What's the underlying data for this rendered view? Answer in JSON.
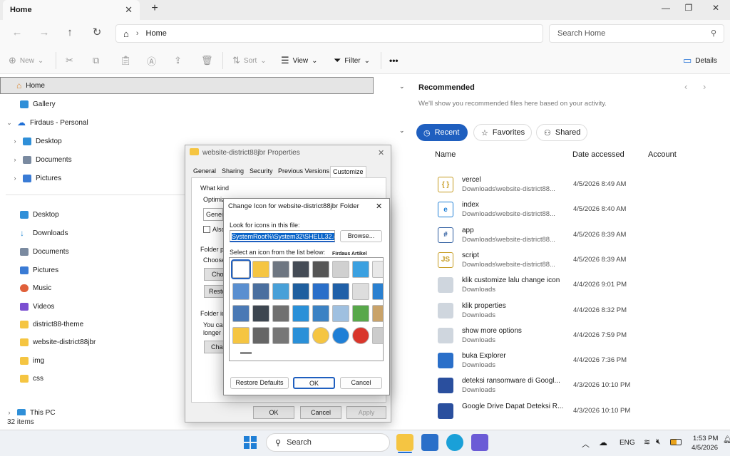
{
  "window": {
    "tab_title": "Home",
    "tab_close": "✕",
    "new_tab": "+",
    "minimize": "—",
    "maximize": "❐",
    "close": "✕"
  },
  "address": {
    "location": "Home",
    "search_placeholder": "Search Home"
  },
  "toolbar": {
    "new_label": "New",
    "sort_label": "Sort",
    "view_label": "View",
    "filter_label": "Filter",
    "more_label": "•••",
    "details_label": "Details"
  },
  "nav": {
    "home": "Home",
    "gallery": "Gallery",
    "onedrive": "Firdaus - Personal",
    "desktop": "Desktop",
    "documents": "Documents",
    "pictures": "Pictures",
    "pinned": [
      {
        "label": "Desktop",
        "color": "#2f8fd8"
      },
      {
        "label": "Downloads",
        "color": "#2f8fd8"
      },
      {
        "label": "Documents",
        "color": "#7a8aa0"
      },
      {
        "label": "Pictures",
        "color": "#3a7bd5"
      },
      {
        "label": "Music",
        "color": "#e0603a"
      },
      {
        "label": "Videos",
        "color": "#7b4fd1"
      },
      {
        "label": "district88-theme",
        "color": "#f5c542"
      },
      {
        "label": "website-district88jbr",
        "color": "#f5c542"
      },
      {
        "label": "img",
        "color": "#f5c542"
      },
      {
        "label": "css",
        "color": "#f5c542"
      }
    ],
    "this_pc": "This PC"
  },
  "status": {
    "items": "32 items"
  },
  "recommended": {
    "title": "Recommended",
    "subtitle": "We'll show you recommended files here based on your activity."
  },
  "filter_tabs": {
    "recent": "Recent",
    "favorites": "Favorites",
    "shared": "Shared"
  },
  "columns": {
    "name": "Name",
    "date": "Date accessed",
    "account": "Account"
  },
  "files": [
    {
      "name": "vercel",
      "loc": "Downloads\\website-district88...",
      "date": "4/5/2026 8:49 AM",
      "icon": "{ }",
      "color": "#c59a1e"
    },
    {
      "name": "index",
      "loc": "Downloads\\website-district88...",
      "date": "4/5/2026 8:40 AM",
      "icon": "e",
      "color": "#1f7fd6"
    },
    {
      "name": "app",
      "loc": "Downloads\\website-district88...",
      "date": "4/5/2026 8:39 AM",
      "icon": "#",
      "color": "#2a5a9e"
    },
    {
      "name": "script",
      "loc": "Downloads\\website-district88...",
      "date": "4/5/2026 8:39 AM",
      "icon": "JS",
      "color": "#c59a1e"
    },
    {
      "name": "klik customize lalu change icon",
      "loc": "Downloads",
      "date": "4/4/2026 9:01 PM",
      "icon": "",
      "color": "#cfd6de"
    },
    {
      "name": "klik properties",
      "loc": "Downloads",
      "date": "4/4/2026 8:32 PM",
      "icon": "",
      "color": "#cfd6de"
    },
    {
      "name": "show more options",
      "loc": "Downloads",
      "date": "4/4/2026 7:59 PM",
      "icon": "",
      "color": "#cfd6de"
    },
    {
      "name": "buka Explorer",
      "loc": "Downloads",
      "date": "4/4/2026 7:36 PM",
      "icon": "",
      "color": "#2a6fc9"
    },
    {
      "name": "deteksi ransomware di Googl...",
      "loc": "Downloads",
      "date": "4/3/2026 10:10 PM",
      "icon": "",
      "color": "#2a4f9e"
    },
    {
      "name": "Google Drive Dapat Deteksi R...",
      "loc": "",
      "date": "4/3/2026 10:10 PM",
      "icon": "",
      "color": "#2a4f9e"
    }
  ],
  "props_dialog": {
    "title": "website-district88jbr Properties",
    "close": "✕",
    "tabs": [
      "General",
      "Sharing",
      "Security",
      "Previous Versions",
      "Customize"
    ],
    "section1": "What kind of folder do you want?",
    "optimize": "Optimize this folder for:",
    "optimize_value": "General items",
    "also": "Also apply this template to all subfolders",
    "section2": "Folder pictures",
    "choose": "Choose a file to show on this folder icon.",
    "choose_btn": "Choose File...",
    "restore_btn": "Restore Default",
    "section3": "Folder icons",
    "icon_text1": "You can change the folder icon. If you change it, it will no",
    "icon_text2": "longer show a preview of the folder's contents.",
    "change_btn": "Change Icon...",
    "ok": "OK",
    "cancel": "Cancel",
    "apply": "Apply"
  },
  "change_dialog": {
    "title": "Change Icon for website-district88jbr Folder",
    "close": "✕",
    "look_label": "Look for icons in this file:",
    "path_value": "SystemRoot%\\System32\\SHELL32.dll",
    "browse": "Browse...",
    "select_label": "Select an icon from the list below:",
    "overlay_label": "Firdaus Artikel",
    "restore": "Restore Defaults",
    "ok": "OK",
    "cancel": "Cancel"
  },
  "taskbar": {
    "search": "Search",
    "lang": "ENG",
    "time": "1:53 PM",
    "date": "4/5/2026"
  }
}
